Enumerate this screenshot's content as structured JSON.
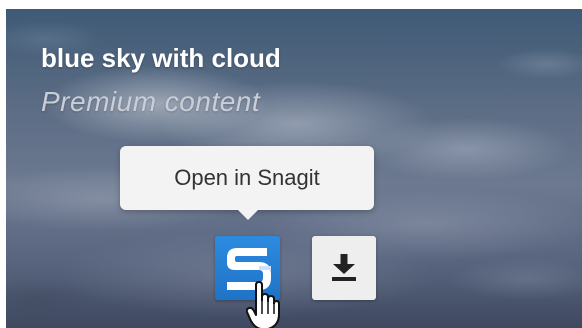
{
  "card": {
    "title": "blue sky with cloud",
    "subtitle": "Premium content"
  },
  "tooltip": {
    "label": "Open in Snagit"
  },
  "buttons": {
    "snagit_icon": "snagit-logo-icon",
    "download_icon": "download-icon"
  },
  "cursor": {
    "icon": "hand-pointer-icon"
  },
  "colors": {
    "snagit_blue": "#2181d6",
    "tooltip_bg": "#f3f3f3",
    "download_bg": "#eeeeee"
  }
}
